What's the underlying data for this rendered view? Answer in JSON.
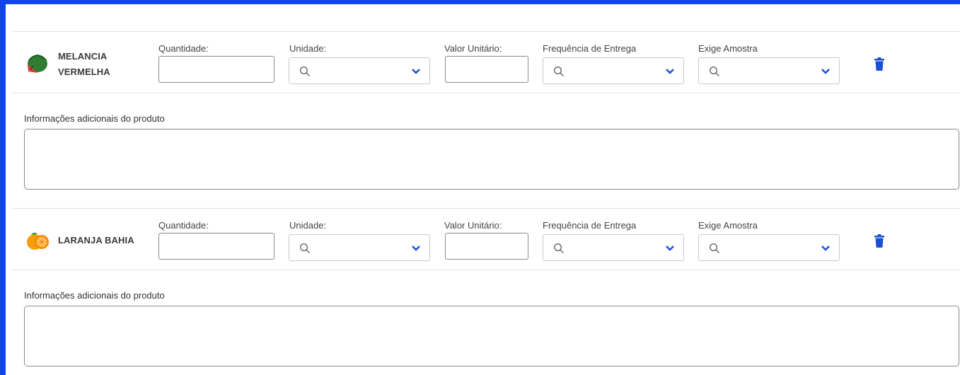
{
  "products": [
    {
      "name": "MELANCIA VERMELHA",
      "name_lines": [
        "MELANCIA",
        "VERMELHA"
      ],
      "icon": "watermelon-icon",
      "fields": {
        "quantidade_label": "Quantidade:",
        "quantidade_value": "",
        "unidade_label": "Unidade:",
        "unidade_value": "",
        "valor_label": "Valor Unitário:",
        "valor_value": "",
        "frequencia_label": "Frequência de Entrega",
        "frequencia_value": "",
        "amostra_label": "Exige Amostra",
        "amostra_value": ""
      },
      "info_label": "Informações adicionais do produto",
      "info_value": ""
    },
    {
      "name": "LARANJA BAHIA",
      "name_lines": [
        "LARANJA BAHIA"
      ],
      "icon": "orange-icon",
      "fields": {
        "quantidade_label": "Quantidade:",
        "quantidade_value": "",
        "unidade_label": "Unidade:",
        "unidade_value": "",
        "valor_label": "Valor Unitário:",
        "valor_value": "",
        "frequencia_label": "Frequência de Entrega",
        "frequencia_value": "",
        "amostra_label": "Exige Amostra",
        "amostra_value": ""
      },
      "info_label": "Informações adicionais do produto",
      "info_value": ""
    }
  ],
  "colors": {
    "frame_border": "#1046e9",
    "trash_icon": "#1a4fd6",
    "chevron": "#1a4fd6"
  }
}
